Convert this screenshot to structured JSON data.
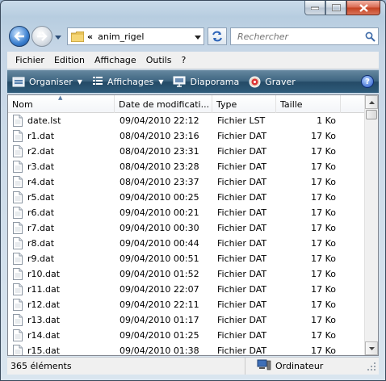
{
  "address": {
    "chevron": "«",
    "path": "anim_rigel"
  },
  "search": {
    "placeholder": "Rechercher"
  },
  "menu": [
    "Fichier",
    "Edition",
    "Affichage",
    "Outils",
    "?"
  ],
  "commands": {
    "organiser": "Organiser",
    "affichages": "Affichages",
    "diaporama": "Diaporama",
    "graver": "Graver",
    "help": "?"
  },
  "columns": {
    "name": "Nom",
    "date": "Date de modificati...",
    "type": "Type",
    "size": "Taille"
  },
  "files": [
    {
      "name": "date.lst",
      "date": "09/04/2010 22:12",
      "type": "Fichier LST",
      "size": "1 Ko"
    },
    {
      "name": "r1.dat",
      "date": "08/04/2010 23:16",
      "type": "Fichier DAT",
      "size": "17 Ko"
    },
    {
      "name": "r2.dat",
      "date": "08/04/2010 23:31",
      "type": "Fichier DAT",
      "size": "17 Ko"
    },
    {
      "name": "r3.dat",
      "date": "08/04/2010 23:28",
      "type": "Fichier DAT",
      "size": "17 Ko"
    },
    {
      "name": "r4.dat",
      "date": "08/04/2010 23:37",
      "type": "Fichier DAT",
      "size": "17 Ko"
    },
    {
      "name": "r5.dat",
      "date": "09/04/2010 00:25",
      "type": "Fichier DAT",
      "size": "17 Ko"
    },
    {
      "name": "r6.dat",
      "date": "09/04/2010 00:21",
      "type": "Fichier DAT",
      "size": "17 Ko"
    },
    {
      "name": "r7.dat",
      "date": "09/04/2010 00:30",
      "type": "Fichier DAT",
      "size": "17 Ko"
    },
    {
      "name": "r8.dat",
      "date": "09/04/2010 00:44",
      "type": "Fichier DAT",
      "size": "17 Ko"
    },
    {
      "name": "r9.dat",
      "date": "09/04/2010 00:51",
      "type": "Fichier DAT",
      "size": "17 Ko"
    },
    {
      "name": "r10.dat",
      "date": "09/04/2010 01:52",
      "type": "Fichier DAT",
      "size": "17 Ko"
    },
    {
      "name": "r11.dat",
      "date": "09/04/2010 22:07",
      "type": "Fichier DAT",
      "size": "17 Ko"
    },
    {
      "name": "r12.dat",
      "date": "09/04/2010 22:11",
      "type": "Fichier DAT",
      "size": "17 Ko"
    },
    {
      "name": "r13.dat",
      "date": "09/04/2010 01:17",
      "type": "Fichier DAT",
      "size": "17 Ko"
    },
    {
      "name": "r14.dat",
      "date": "09/04/2010 01:25",
      "type": "Fichier DAT",
      "size": "17 Ko"
    },
    {
      "name": "r15.dat",
      "date": "09/04/2010 01:38",
      "type": "Fichier DAT",
      "size": "17 Ko"
    }
  ],
  "status": {
    "count": "365 éléments",
    "location": "Ordinateur"
  },
  "colors": {
    "command_bar": "#2f5c7b",
    "window_frame": "#b7cde0"
  }
}
